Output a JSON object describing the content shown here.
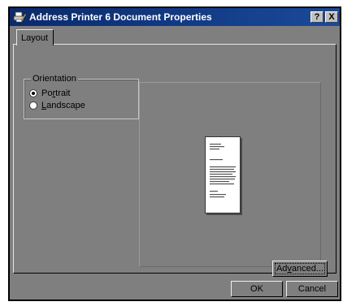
{
  "window": {
    "title": "Address Printer 6  Document Properties",
    "title_icon": "printer-properties-icon",
    "help_button_label": "?",
    "close_button_label": "X"
  },
  "tabs": [
    {
      "label": "Layout",
      "selected": true
    }
  ],
  "orientation": {
    "group_label": "Orientation",
    "options": [
      {
        "prefix": "Po",
        "accel": "r",
        "suffix": "trait",
        "checked": true
      },
      {
        "prefix": "",
        "accel": "L",
        "suffix": "andscape",
        "checked": false
      }
    ]
  },
  "preview": {
    "icon": "document-page-icon",
    "orientation": "portrait"
  },
  "buttons": {
    "advanced": {
      "prefix": "Ad",
      "accel": "v",
      "suffix": "anced..."
    },
    "ok": "OK",
    "cancel": "Cancel"
  },
  "colors": {
    "titlebar": "#123b86",
    "dialog_bg": "#7f7f7f"
  }
}
